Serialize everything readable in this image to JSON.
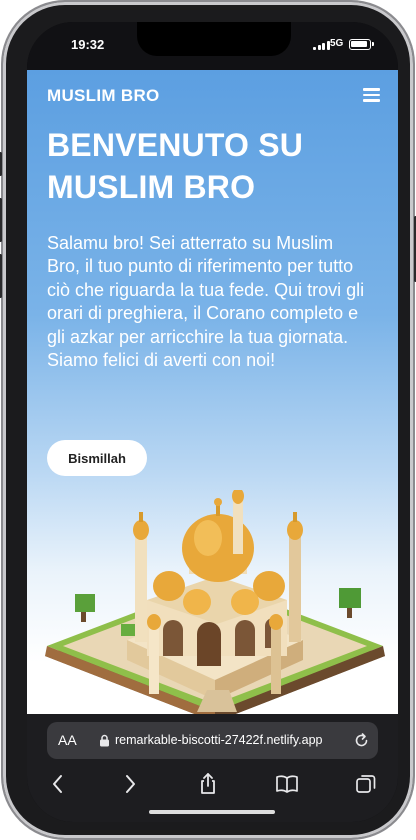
{
  "status": {
    "time": "19:32",
    "network": "5G"
  },
  "site": {
    "logo": "MUSLIM BRO",
    "hero_title": "BENVENUTO SU MUSLIM BRO",
    "hero_text": "Salamu bro! Sei atterrato su Muslim Bro, il tuo punto di riferimento per tutto ciò che riguarda la tua fede. Qui trovi gli orari di preghiera, il Corano completo e gli azkar per arricchire la tua giornata. Siamo felici di averti con noi!",
    "cta_label": "Bismillah",
    "colors": {
      "accent": "#5c9fe1",
      "text": "#ffffff"
    }
  },
  "browser": {
    "text_size_label": "AA",
    "url": "remarkable-biscotti-27422f.netlify.app",
    "toolbar_icons": [
      "back-icon",
      "forward-icon",
      "share-icon",
      "bookmarks-icon",
      "tabs-icon"
    ]
  }
}
